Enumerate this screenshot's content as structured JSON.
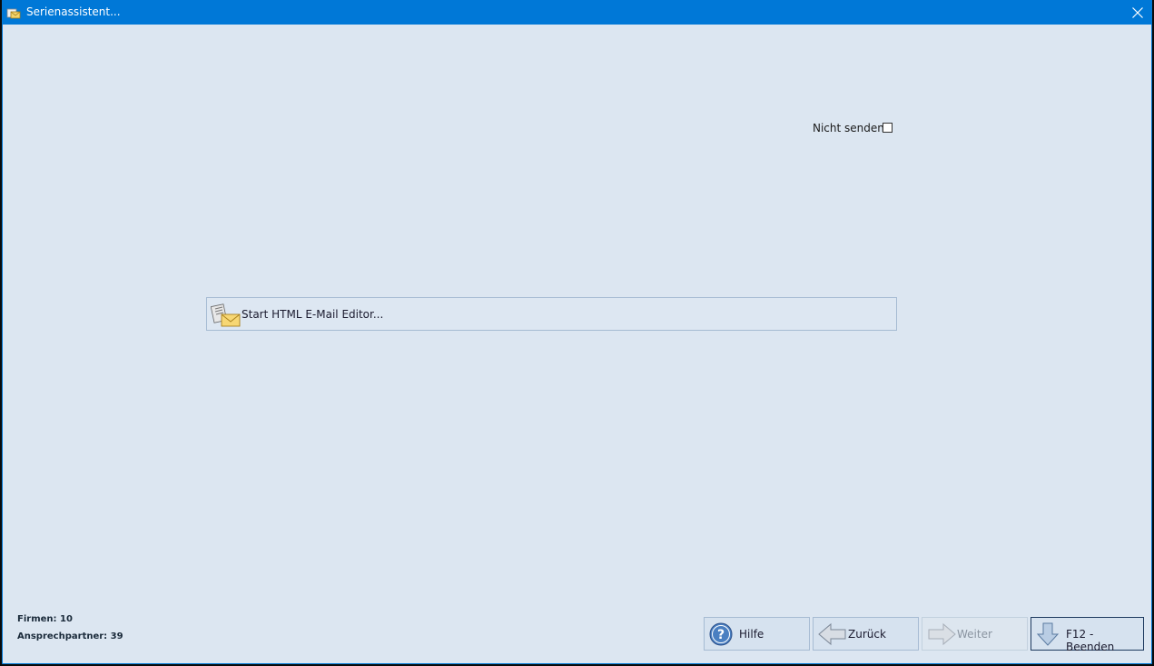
{
  "window": {
    "title": "Serienassistent..."
  },
  "options": {
    "nicht_senden_label": "Nicht senden:",
    "nicht_senden_checked": false
  },
  "editor": {
    "button_label": "Start HTML E-Mail Editor..."
  },
  "stats": {
    "firmen": "Firmen: 10",
    "ansprechpartner": "Ansprechpartner: 39"
  },
  "footer": {
    "hilfe_label": "Hilfe",
    "zurueck_label": "Zurück",
    "weiter_label": "Weiter",
    "beenden_label": "F12 - Beenden"
  },
  "colors": {
    "titlebar": "#0078d7",
    "window_bg": "#dce6f1",
    "button_border": "#a6bbd3",
    "default_button_border": "#1e3a5f"
  }
}
